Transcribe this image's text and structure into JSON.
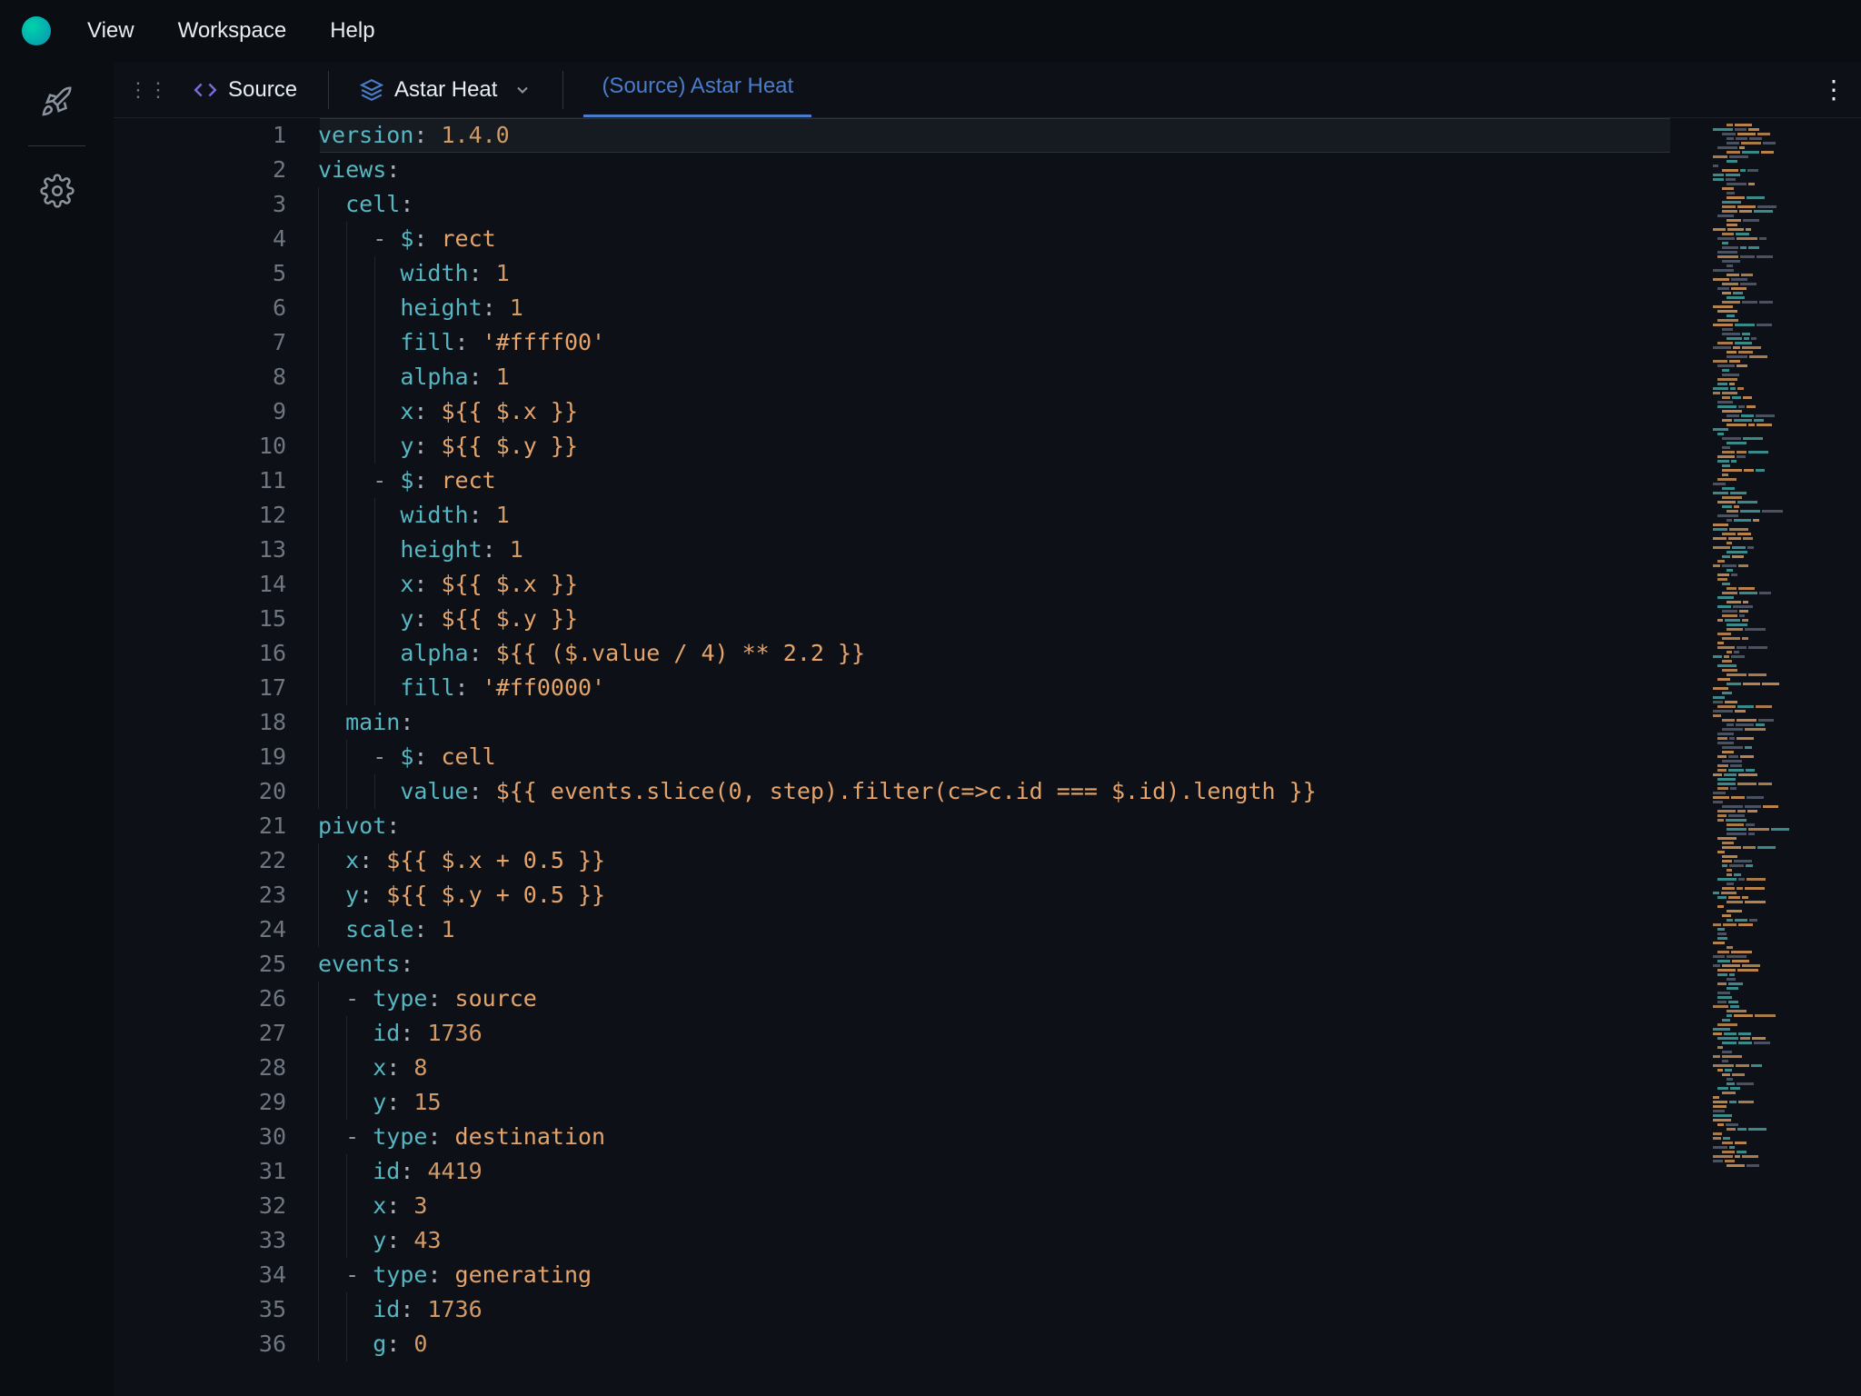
{
  "menu": {
    "view": "View",
    "workspace": "Workspace",
    "help": "Help"
  },
  "tabs": {
    "source_label": "Source",
    "project_label": "Astar Heat",
    "active_label": "(Source) Astar Heat"
  },
  "code": {
    "lines": [
      {
        "n": 1,
        "indent": 0,
        "tokens": [
          [
            "key",
            "version"
          ],
          [
            "punc",
            ": "
          ],
          [
            "num",
            "1.4.0"
          ]
        ]
      },
      {
        "n": 2,
        "indent": 0,
        "tokens": [
          [
            "key",
            "views"
          ],
          [
            "punc",
            ":"
          ]
        ]
      },
      {
        "n": 3,
        "indent": 1,
        "tokens": [
          [
            "key",
            "cell"
          ],
          [
            "punc",
            ":"
          ]
        ]
      },
      {
        "n": 4,
        "indent": 2,
        "tokens": [
          [
            "dash",
            "- "
          ],
          [
            "key",
            "$"
          ],
          [
            "punc",
            ": "
          ],
          [
            "str",
            "rect"
          ]
        ]
      },
      {
        "n": 5,
        "indent": 3,
        "tokens": [
          [
            "key",
            "width"
          ],
          [
            "punc",
            ": "
          ],
          [
            "num",
            "1"
          ]
        ]
      },
      {
        "n": 6,
        "indent": 3,
        "tokens": [
          [
            "key",
            "height"
          ],
          [
            "punc",
            ": "
          ],
          [
            "num",
            "1"
          ]
        ]
      },
      {
        "n": 7,
        "indent": 3,
        "tokens": [
          [
            "key",
            "fill"
          ],
          [
            "punc",
            ": "
          ],
          [
            "str",
            "'#ffff00'"
          ]
        ]
      },
      {
        "n": 8,
        "indent": 3,
        "tokens": [
          [
            "key",
            "alpha"
          ],
          [
            "punc",
            ": "
          ],
          [
            "num",
            "1"
          ]
        ]
      },
      {
        "n": 9,
        "indent": 3,
        "tokens": [
          [
            "key",
            "x"
          ],
          [
            "punc",
            ": "
          ],
          [
            "tpl",
            "${{ $.x }}"
          ]
        ]
      },
      {
        "n": 10,
        "indent": 3,
        "tokens": [
          [
            "key",
            "y"
          ],
          [
            "punc",
            ": "
          ],
          [
            "tpl",
            "${{ $.y }}"
          ]
        ]
      },
      {
        "n": 11,
        "indent": 2,
        "tokens": [
          [
            "dash",
            "- "
          ],
          [
            "key",
            "$"
          ],
          [
            "punc",
            ": "
          ],
          [
            "str",
            "rect"
          ]
        ]
      },
      {
        "n": 12,
        "indent": 3,
        "tokens": [
          [
            "key",
            "width"
          ],
          [
            "punc",
            ": "
          ],
          [
            "num",
            "1"
          ]
        ]
      },
      {
        "n": 13,
        "indent": 3,
        "tokens": [
          [
            "key",
            "height"
          ],
          [
            "punc",
            ": "
          ],
          [
            "num",
            "1"
          ]
        ]
      },
      {
        "n": 14,
        "indent": 3,
        "tokens": [
          [
            "key",
            "x"
          ],
          [
            "punc",
            ": "
          ],
          [
            "tpl",
            "${{ $.x }}"
          ]
        ]
      },
      {
        "n": 15,
        "indent": 3,
        "tokens": [
          [
            "key",
            "y"
          ],
          [
            "punc",
            ": "
          ],
          [
            "tpl",
            "${{ $.y }}"
          ]
        ]
      },
      {
        "n": 16,
        "indent": 3,
        "tokens": [
          [
            "key",
            "alpha"
          ],
          [
            "punc",
            ": "
          ],
          [
            "tpl",
            "${{ ($.value / 4) ** 2.2 }}"
          ]
        ]
      },
      {
        "n": 17,
        "indent": 3,
        "tokens": [
          [
            "key",
            "fill"
          ],
          [
            "punc",
            ": "
          ],
          [
            "str",
            "'#ff0000'"
          ]
        ]
      },
      {
        "n": 18,
        "indent": 1,
        "tokens": [
          [
            "key",
            "main"
          ],
          [
            "punc",
            ":"
          ]
        ]
      },
      {
        "n": 19,
        "indent": 2,
        "tokens": [
          [
            "dash",
            "- "
          ],
          [
            "key",
            "$"
          ],
          [
            "punc",
            ": "
          ],
          [
            "str",
            "cell"
          ]
        ]
      },
      {
        "n": 20,
        "indent": 3,
        "tokens": [
          [
            "key",
            "value"
          ],
          [
            "punc",
            ": "
          ],
          [
            "tpl",
            "${{ events.slice(0, step).filter(c=>c.id === $.id).length }}"
          ]
        ]
      },
      {
        "n": 21,
        "indent": 0,
        "tokens": [
          [
            "key",
            "pivot"
          ],
          [
            "punc",
            ":"
          ]
        ]
      },
      {
        "n": 22,
        "indent": 1,
        "tokens": [
          [
            "key",
            "x"
          ],
          [
            "punc",
            ": "
          ],
          [
            "tpl",
            "${{ $.x + 0.5 }}"
          ]
        ]
      },
      {
        "n": 23,
        "indent": 1,
        "tokens": [
          [
            "key",
            "y"
          ],
          [
            "punc",
            ": "
          ],
          [
            "tpl",
            "${{ $.y + 0.5 }}"
          ]
        ]
      },
      {
        "n": 24,
        "indent": 1,
        "tokens": [
          [
            "key",
            "scale"
          ],
          [
            "punc",
            ": "
          ],
          [
            "num",
            "1"
          ]
        ]
      },
      {
        "n": 25,
        "indent": 0,
        "tokens": [
          [
            "key",
            "events"
          ],
          [
            "punc",
            ":"
          ]
        ]
      },
      {
        "n": 26,
        "indent": 1,
        "tokens": [
          [
            "dash",
            "- "
          ],
          [
            "key",
            "type"
          ],
          [
            "punc",
            ": "
          ],
          [
            "str",
            "source"
          ]
        ]
      },
      {
        "n": 27,
        "indent": 2,
        "tokens": [
          [
            "key",
            "id"
          ],
          [
            "punc",
            ": "
          ],
          [
            "num",
            "1736"
          ]
        ]
      },
      {
        "n": 28,
        "indent": 2,
        "tokens": [
          [
            "key",
            "x"
          ],
          [
            "punc",
            ": "
          ],
          [
            "num",
            "8"
          ]
        ]
      },
      {
        "n": 29,
        "indent": 2,
        "tokens": [
          [
            "key",
            "y"
          ],
          [
            "punc",
            ": "
          ],
          [
            "num",
            "15"
          ]
        ]
      },
      {
        "n": 30,
        "indent": 1,
        "tokens": [
          [
            "dash",
            "- "
          ],
          [
            "key",
            "type"
          ],
          [
            "punc",
            ": "
          ],
          [
            "str",
            "destination"
          ]
        ]
      },
      {
        "n": 31,
        "indent": 2,
        "tokens": [
          [
            "key",
            "id"
          ],
          [
            "punc",
            ": "
          ],
          [
            "num",
            "4419"
          ]
        ]
      },
      {
        "n": 32,
        "indent": 2,
        "tokens": [
          [
            "key",
            "x"
          ],
          [
            "punc",
            ": "
          ],
          [
            "num",
            "3"
          ]
        ]
      },
      {
        "n": 33,
        "indent": 2,
        "tokens": [
          [
            "key",
            "y"
          ],
          [
            "punc",
            ": "
          ],
          [
            "num",
            "43"
          ]
        ]
      },
      {
        "n": 34,
        "indent": 1,
        "tokens": [
          [
            "dash",
            "- "
          ],
          [
            "key",
            "type"
          ],
          [
            "punc",
            ": "
          ],
          [
            "str",
            "generating"
          ]
        ]
      },
      {
        "n": 35,
        "indent": 2,
        "tokens": [
          [
            "key",
            "id"
          ],
          [
            "punc",
            ": "
          ],
          [
            "num",
            "1736"
          ]
        ]
      },
      {
        "n": 36,
        "indent": 2,
        "tokens": [
          [
            "key",
            "g"
          ],
          [
            "punc",
            ": "
          ],
          [
            "num",
            "0"
          ]
        ]
      }
    ]
  }
}
